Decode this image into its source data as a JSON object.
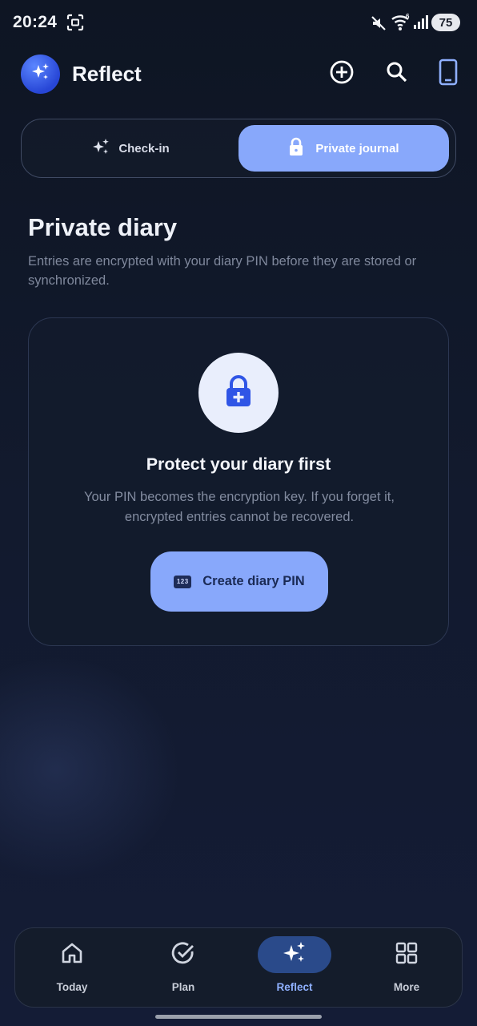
{
  "status_bar": {
    "time": "20:24",
    "battery": "75",
    "icons": [
      "screenshot-icon",
      "mute-icon",
      "wifi-icon",
      "signal-icon"
    ]
  },
  "app_bar": {
    "title": "Reflect",
    "logo_icon": "sparkles-icon",
    "actions": [
      "add-circle-icon",
      "search-icon",
      "phone-icon"
    ]
  },
  "segmented": {
    "checkin_label": "Check-in",
    "checkin_icon": "sparkles-icon",
    "private_label": "Private journal",
    "private_icon": "lock-icon",
    "selected": "Private journal"
  },
  "header": {
    "title": "Private diary",
    "subtitle": "Entries are encrypted with your diary PIN before they are stored or synchronized."
  },
  "card": {
    "icon": "lock-plus-icon",
    "title": "Protect your diary first",
    "body": "Your PIN becomes the encryption key. If you forget it, encrypted entries cannot be recovered.",
    "button_label": "Create diary PIN",
    "button_icon_text": "123"
  },
  "bottom_nav": {
    "items": [
      {
        "label": "Today",
        "icon": "home-icon"
      },
      {
        "label": "Plan",
        "icon": "check-circle-icon"
      },
      {
        "label": "Reflect",
        "icon": "sparkles-icon"
      },
      {
        "label": "More",
        "icon": "grid-icon"
      }
    ],
    "active": "Reflect"
  },
  "colors": {
    "background": "#101727",
    "accent": "#88a8fb",
    "active_nav_bg": "#2a4a8a",
    "logo": "#2f55e6"
  }
}
